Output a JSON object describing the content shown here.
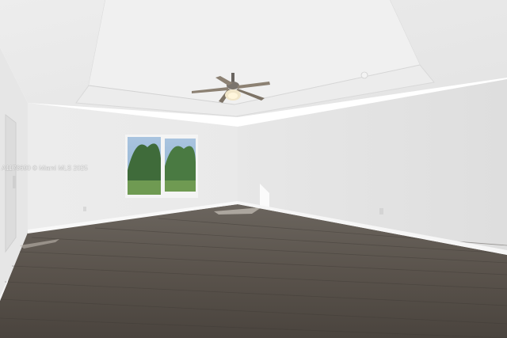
{
  "photo": {
    "watermark": "A1178690 © Miami MLS 2025"
  },
  "colors": {
    "ceiling": "#e9e9e9",
    "wall_left": "#ececec",
    "wall_right": "#e4e4e4",
    "floor_dark": "#4c4640",
    "floor_light": "#6f6860",
    "baseboard": "#f7f7f7",
    "window_glass": "#7fa3c8",
    "foliage": "#3f6b3a"
  },
  "icons": [
    "ceiling-fan-icon",
    "window-icon",
    "outlet-icon",
    "door-icon"
  ]
}
